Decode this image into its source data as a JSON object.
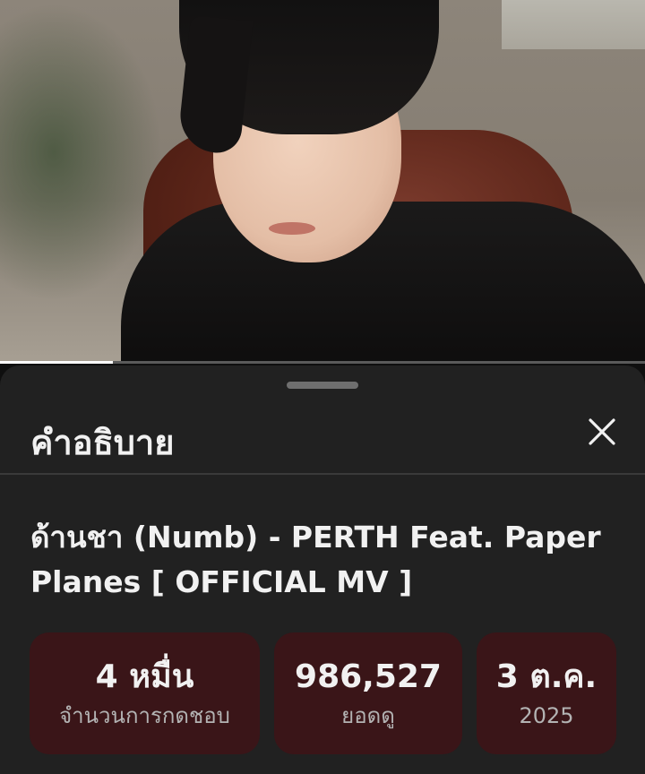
{
  "video": {
    "progress_fraction": 0.175
  },
  "description_sheet": {
    "title": "คำอธิบาย",
    "close_icon": "close-icon",
    "video_title": "ด้านชา (Numb) - PERTH Feat. Paper Planes [ OFFICIAL MV ]",
    "stats": [
      {
        "value": "4 หมื่น",
        "label": "จำนวนการกดชอบ"
      },
      {
        "value": "986,527",
        "label": "ยอดดู"
      },
      {
        "value": "3 ต.ค.",
        "label": "2025"
      }
    ]
  },
  "colors": {
    "sheet_bg": "#212121",
    "stat_card_bg": "#3a1518",
    "progress_fill": "#ffffff"
  }
}
